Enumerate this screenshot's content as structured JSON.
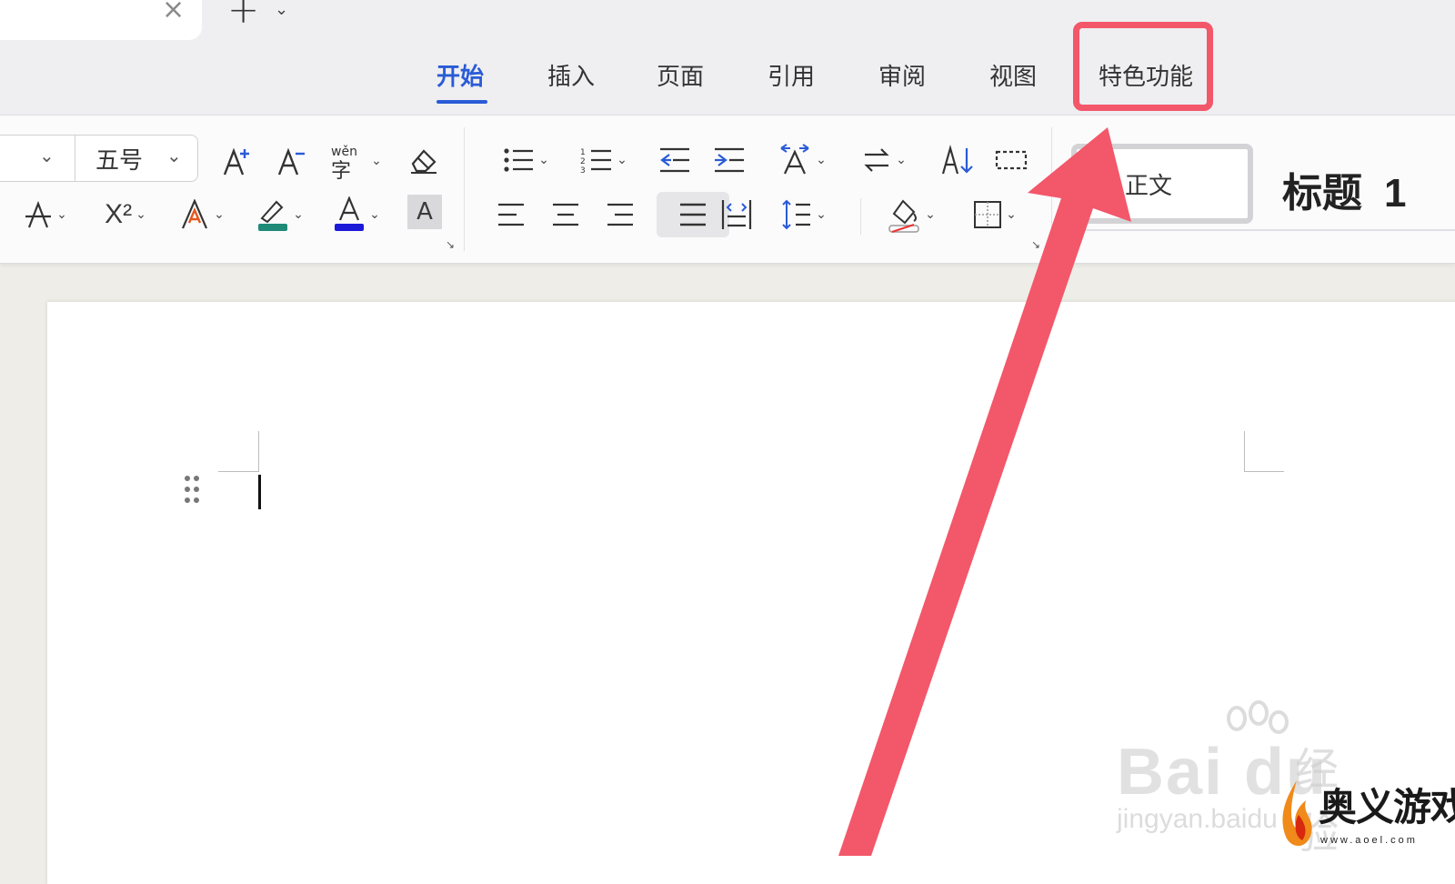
{
  "window": {
    "tab_close_icon": "close-icon",
    "new_tab_icon": "plus-icon"
  },
  "ribbon": {
    "tabs": [
      {
        "label": "开始",
        "active": true
      },
      {
        "label": "插入"
      },
      {
        "label": "页面"
      },
      {
        "label": "引用"
      },
      {
        "label": "审阅"
      },
      {
        "label": "视图"
      },
      {
        "label": "特色功能",
        "highlighted": true
      }
    ],
    "accent_color": "#2a5bd7"
  },
  "toolbar": {
    "font_size_value": "五号",
    "row1_icons": [
      "increase-font-icon",
      "decrease-font-icon",
      "phonetic-guide-icon",
      "clear-format-icon",
      "bullet-list-icon",
      "numbered-list-icon",
      "decrease-indent-icon",
      "increase-indent-icon",
      "text-direction-icon",
      "convert-icon",
      "sort-icon",
      "show-hide-icon"
    ],
    "row2_icons": [
      "strikethrough-icon",
      "superscript-icon",
      "text-effect-icon",
      "highlight-icon",
      "font-color-icon",
      "char-shading-icon",
      "align-left-icon",
      "align-center-icon",
      "align-right-icon",
      "justify-icon",
      "distribute-icon",
      "line-spacing-icon",
      "shading-icon",
      "borders-icon"
    ],
    "glyphs": {
      "increase_font": "A⁺",
      "decrease_font": "A⁻",
      "phonetic": "wěn\n字",
      "superscript": "X²",
      "char_shading": "A",
      "font_color_letter": "A"
    },
    "colors": {
      "highlight": "#1f8a78",
      "font_color": "#1a1ad8",
      "text_effect": "#e2571e",
      "blue_icon": "#2a5bd7"
    }
  },
  "styles": {
    "normal": "正文",
    "heading1": "标题",
    "heading1_num": "1"
  },
  "annotation": {
    "color": "#f3576a"
  },
  "watermarks": {
    "baidu_text": "Bai du",
    "baidu_cn": "经验",
    "baidu_sub": "jingyan.baidu",
    "site_title": "奥义游戏网",
    "site_url": "www.aoel.com"
  }
}
